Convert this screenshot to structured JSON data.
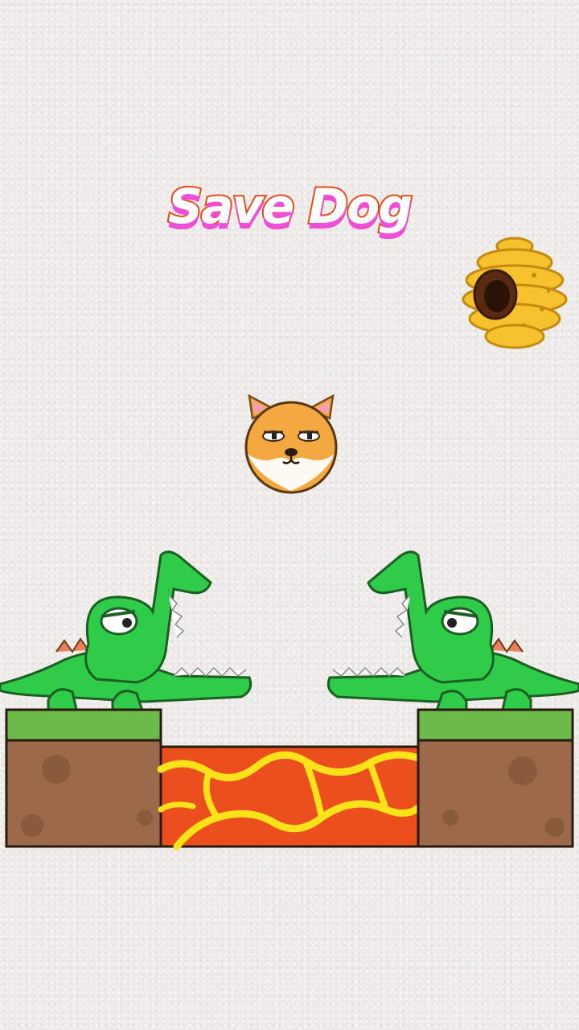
{
  "game": {
    "title": "Save Dog"
  },
  "colors": {
    "background": "#ecebe8",
    "title_fill": "#ffffff",
    "title_outline": "#e94a1c",
    "title_shadow": "#ee4fd4",
    "crocodile_green": "#2ecc48",
    "grass": "#6cbb4a",
    "dirt": "#9c6a4a",
    "lava_red": "#ea4f1d",
    "lava_yellow": "#ffe21a",
    "dog_orange": "#f3a93f",
    "hive_yellow": "#f5c12c"
  },
  "icons": {
    "dog": "shiba-dog-ball-icon",
    "beehive": "beehive-icon",
    "crocodile": "crocodile-icon",
    "lava": "lava-pit-icon"
  }
}
